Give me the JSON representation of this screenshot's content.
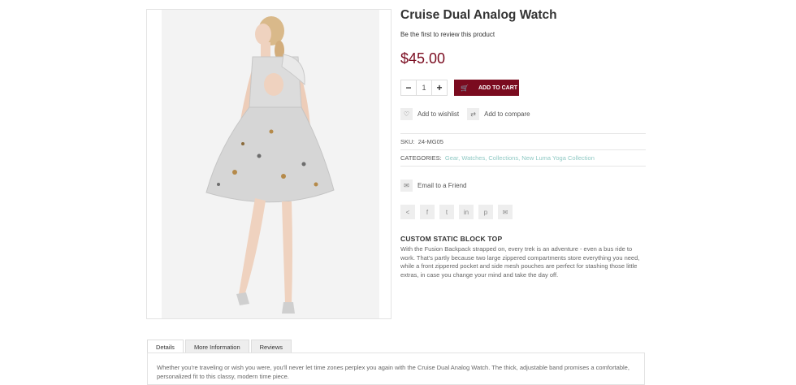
{
  "product": {
    "title": "Cruise Dual Analog Watch",
    "review_link": "Be the first to review this product",
    "price": "$45.00",
    "quantity": "1",
    "add_to_cart": "ADD TO CART",
    "wishlist": "Add to wishlist",
    "compare": "Add to compare",
    "sku_label": "SKU:",
    "sku_value": "24-MG05",
    "categories_label": "CATEGORIES:",
    "categories": [
      "Gear",
      "Watches",
      "Collections",
      "New Luma Yoga Collection"
    ],
    "email_friend": "Email to a Friend"
  },
  "share_icons": [
    "share-icon",
    "facebook-icon",
    "twitter-icon",
    "linkedin-icon",
    "pinterest-icon",
    "mail-icon"
  ],
  "static_block": {
    "title": "CUSTOM STATIC BLOCK TOP",
    "text": "With the Fusion Backpack strapped on, every trek is an adventure - even a bus ride to work. That's partly because two large zippered compartments store everything you need, while a front zippered pocket and side mesh pouches are perfect for stashing those little extras, in case you change your mind and take the day off."
  },
  "tabs": [
    {
      "label": "Details"
    },
    {
      "label": "More Information"
    },
    {
      "label": "Reviews"
    }
  ],
  "details_text": "Whether you're traveling or wish you were, you'll never let time zones perplex you again with the Cruise Dual Analog Watch. The thick, adjustable band promises a comfortable, personalized fit to this classy, modern time piece.",
  "colors": {
    "accent": "#7a0b1f",
    "link": "#8fc9c4"
  }
}
